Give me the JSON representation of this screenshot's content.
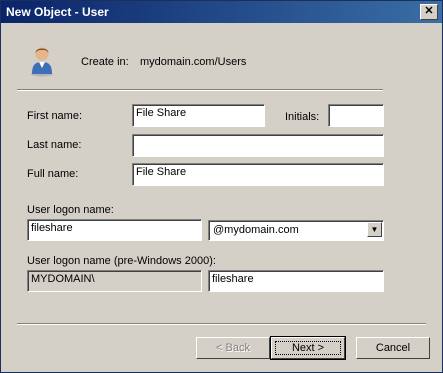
{
  "window": {
    "title": "New Object - User",
    "close_glyph": "✕"
  },
  "header": {
    "create_in_label": "Create in:",
    "create_in_value": "mydomain.com/Users",
    "icon": "user-icon"
  },
  "form": {
    "first_name_label": "First name:",
    "first_name_value": "File Share",
    "initials_label": "Initials:",
    "initials_value": "",
    "last_name_label": "Last name:",
    "last_name_value": "",
    "full_name_label": "Full name:",
    "full_name_value": "File Share",
    "logon_name_label": "User logon name:",
    "logon_name_value": "fileshare",
    "upn_suffix_value": "@mydomain.com",
    "pre2000_label": "User logon name (pre-Windows 2000):",
    "pre2000_domain_value": "MYDOMAIN\\",
    "pre2000_name_value": "fileshare"
  },
  "buttons": {
    "back_label": "< Back",
    "next_label": "Next >",
    "cancel_label": "Cancel"
  }
}
